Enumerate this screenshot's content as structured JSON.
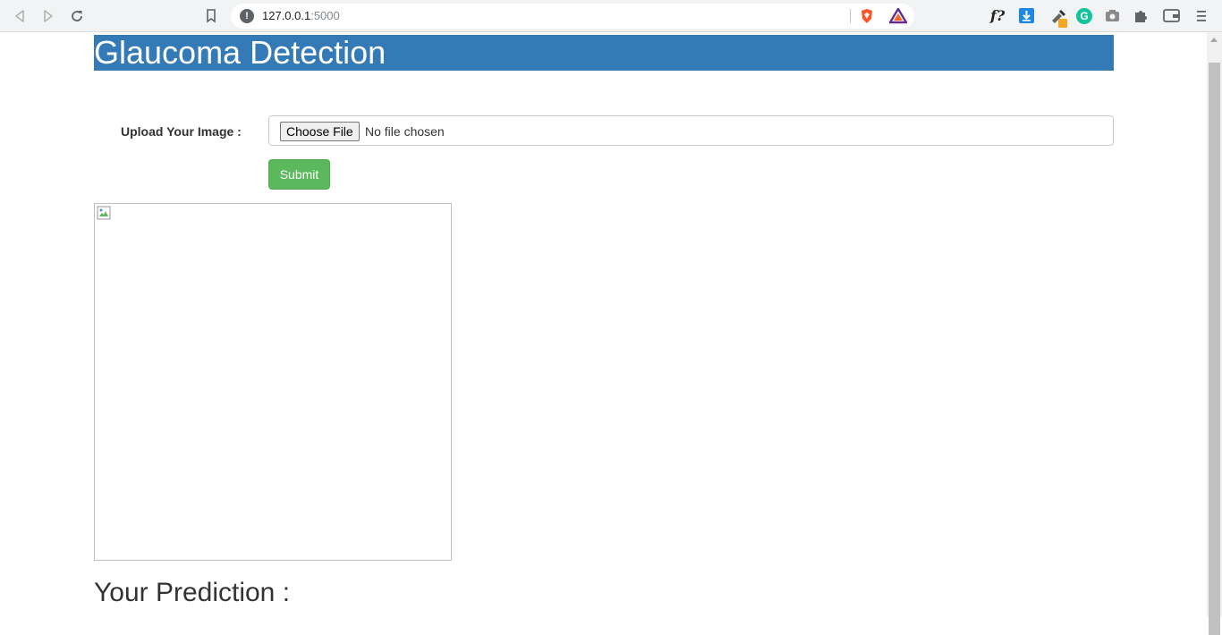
{
  "browser": {
    "url_host": "127.0.0.1",
    "url_port": ":5000",
    "security_icon": "info-icon",
    "toolbar_icons": [
      "back-icon",
      "forward-icon",
      "reload-icon",
      "bookmark-icon",
      "brave-shields-icon",
      "brave-rewards-icon",
      "fx-extension-icon",
      "download-extension-icon",
      "eyedropper-extension-icon",
      "grammarly-icon",
      "screenshot-icon",
      "extensions-icon",
      "wallet-icon",
      "menu-icon"
    ],
    "extension_fx_label": "f?",
    "grammarly_label": "G"
  },
  "page": {
    "title": "Glaucoma Detection",
    "header_color": "#337ab7",
    "upload_label": "Upload Your Image :",
    "choose_file_label": "Choose File",
    "file_status": "No file chosen",
    "submit_label": "Submit",
    "submit_color": "#5cb85c",
    "prediction_label": "Your Prediction :"
  }
}
